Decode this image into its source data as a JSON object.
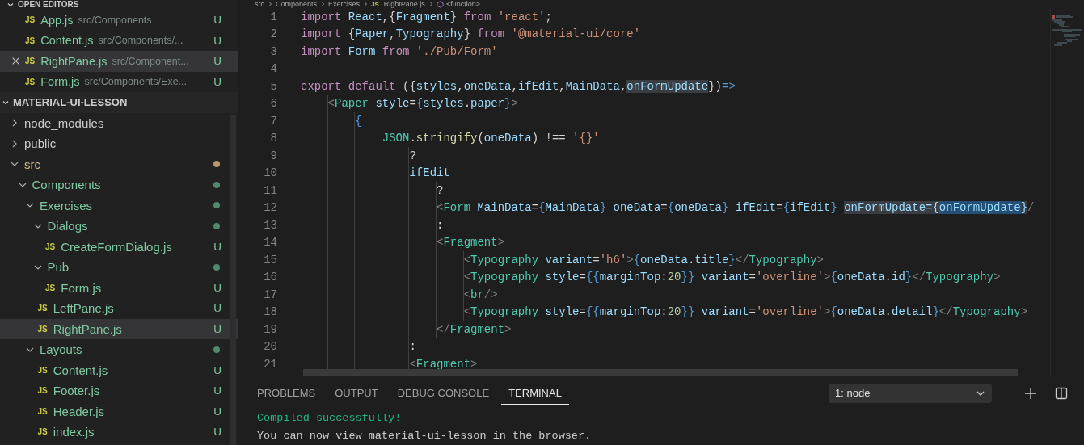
{
  "explorer": {
    "open_editors_title": "OPEN EDITORS",
    "open_editors": [
      {
        "type_icon": "JS",
        "name": "App.js",
        "path": "src/Components",
        "status": "U",
        "selected": false
      },
      {
        "type_icon": "JS",
        "name": "Content.js",
        "path": "src/Components/...",
        "status": "U",
        "selected": false
      },
      {
        "type_icon": "JS",
        "name": "RightPane.js",
        "path": "src/Component...",
        "status": "U",
        "selected": true
      },
      {
        "type_icon": "JS",
        "name": "Form.js",
        "path": "src/Components/Exe...",
        "status": "U",
        "selected": false
      }
    ],
    "project_title": "MATERIAL-UI-LESSON",
    "tree": [
      {
        "kind": "folder",
        "name": "node_modules",
        "expanded": false,
        "selected": false
      },
      {
        "kind": "folder",
        "name": "public",
        "expanded": false,
        "selected": false
      },
      {
        "kind": "folder",
        "name": "src",
        "expanded": true,
        "selected": false,
        "color": "#b89a6a",
        "children": [
          {
            "kind": "folder",
            "name": "Components",
            "expanded": true,
            "selected": false,
            "color": "#4f8a6f",
            "children": [
              {
                "kind": "folder",
                "name": "Exercises",
                "expanded": true,
                "selected": false,
                "color": "#4f8a6f",
                "children": [
                  {
                    "kind": "folder",
                    "name": "Dialogs",
                    "expanded": true,
                    "selected": false,
                    "color": "#4f8a6f",
                    "children": [
                      {
                        "kind": "file",
                        "type_icon": "JS",
                        "name": "CreateFormDialog.js",
                        "status": "U",
                        "selected": false
                      }
                    ]
                  },
                  {
                    "kind": "folder",
                    "name": "Pub",
                    "expanded": true,
                    "selected": false,
                    "color": "#4f8a6f",
                    "children": [
                      {
                        "kind": "file",
                        "type_icon": "JS",
                        "name": "Form.js",
                        "status": "U",
                        "selected": false
                      }
                    ]
                  },
                  {
                    "kind": "file",
                    "type_icon": "JS",
                    "name": "LeftPane.js",
                    "status": "U",
                    "selected": false
                  },
                  {
                    "kind": "file",
                    "type_icon": "JS",
                    "name": "RightPane.js",
                    "status": "U",
                    "selected": true
                  }
                ]
              },
              {
                "kind": "folder",
                "name": "Layouts",
                "expanded": true,
                "selected": false,
                "color": "#4f8a6f",
                "children": [
                  {
                    "kind": "file",
                    "type_icon": "JS",
                    "name": "Content.js",
                    "status": "U",
                    "selected": false
                  },
                  {
                    "kind": "file",
                    "type_icon": "JS",
                    "name": "Footer.js",
                    "status": "U",
                    "selected": false
                  },
                  {
                    "kind": "file",
                    "type_icon": "JS",
                    "name": "Header.js",
                    "status": "U",
                    "selected": false
                  },
                  {
                    "kind": "file",
                    "type_icon": "JS",
                    "name": "index.js",
                    "status": "U",
                    "selected": false
                  }
                ]
              }
            ]
          }
        ]
      }
    ]
  },
  "editor": {
    "breadcrumbs": [
      {
        "kind": "folder",
        "text": "src"
      },
      {
        "kind": "folder",
        "text": "Components"
      },
      {
        "kind": "folder",
        "text": "Exercises"
      },
      {
        "kind": "file",
        "type_icon": "JS",
        "text": "RightPane.js"
      },
      {
        "kind": "symbol",
        "text": "<function>"
      }
    ],
    "lines": [
      {
        "number": "1",
        "tokens": [
          {
            "kind": "kw",
            "text": "import "
          },
          {
            "kind": "var",
            "text": "React"
          },
          {
            "kind": "p",
            "text": ",{"
          },
          {
            "kind": "var",
            "text": "Fragment"
          },
          {
            "kind": "p",
            "text": "} "
          },
          {
            "kind": "kw",
            "text": "from "
          },
          {
            "kind": "str",
            "text": "'react'"
          },
          {
            "kind": "p",
            "text": ";"
          }
        ]
      },
      {
        "number": "2",
        "tokens": [
          {
            "kind": "kw",
            "text": "import "
          },
          {
            "kind": "p",
            "text": "{"
          },
          {
            "kind": "var",
            "text": "Paper"
          },
          {
            "kind": "p",
            "text": ","
          },
          {
            "kind": "var",
            "text": "Typography"
          },
          {
            "kind": "p",
            "text": "} "
          },
          {
            "kind": "kw",
            "text": "from "
          },
          {
            "kind": "str",
            "text": "'@material-ui/core'"
          }
        ]
      },
      {
        "number": "3",
        "tokens": [
          {
            "kind": "kw",
            "text": "import "
          },
          {
            "kind": "var",
            "text": "Form "
          },
          {
            "kind": "kw",
            "text": "from "
          },
          {
            "kind": "str",
            "text": "'./Pub/Form'"
          }
        ]
      },
      {
        "number": "4"
      },
      {
        "number": "5",
        "tokens": [
          {
            "kind": "kw",
            "text": "export default "
          },
          {
            "kind": "p",
            "text": "({"
          },
          {
            "kind": "var",
            "text": "styles"
          },
          {
            "kind": "p",
            "text": ","
          },
          {
            "kind": "var",
            "text": "oneData"
          },
          {
            "kind": "p",
            "text": ","
          },
          {
            "kind": "var",
            "text": "ifEdit"
          },
          {
            "kind": "p",
            "text": ","
          },
          {
            "kind": "var",
            "text": "MainData"
          },
          {
            "kind": "p",
            "text": ","
          },
          {
            "kind": "hl",
            "text": "onFormUpdate"
          },
          {
            "kind": "p",
            "text": "})"
          },
          {
            "kind": "op",
            "text": "=>"
          }
        ],
        "children": [
          {
            "number": "6",
            "tokens": [
              {
                "kind": "angle",
                "text": "<"
              },
              {
                "kind": "tag",
                "text": "Paper "
              },
              {
                "kind": "var",
                "text": "style"
              },
              {
                "kind": "p",
                "text": "="
              },
              {
                "kind": "op",
                "text": "{"
              },
              {
                "kind": "var",
                "text": "styles"
              },
              {
                "kind": "p",
                "text": "."
              },
              {
                "kind": "var",
                "text": "paper"
              },
              {
                "kind": "op",
                "text": "}"
              },
              {
                "kind": "angle",
                "text": ">"
              }
            ],
            "children": [
              {
                "number": "7",
                "tokens": [
                  {
                    "kind": "op",
                    "text": "{"
                  }
                ],
                "children": [
                  {
                    "number": "8",
                    "tokens": [
                      {
                        "kind": "cls",
                        "text": "JSON"
                      },
                      {
                        "kind": "p",
                        "text": "."
                      },
                      {
                        "kind": "fn",
                        "text": "stringify"
                      },
                      {
                        "kind": "p",
                        "text": "("
                      },
                      {
                        "kind": "var",
                        "text": "oneData"
                      },
                      {
                        "kind": "p",
                        "text": ") !== "
                      },
                      {
                        "kind": "str",
                        "text": "'{}'"
                      }
                    ],
                    "children": [
                      {
                        "number": "9",
                        "tokens": [
                          {
                            "kind": "p",
                            "text": "?"
                          }
                        ]
                      },
                      {
                        "number": "10",
                        "tokens": [
                          {
                            "kind": "var",
                            "text": "ifEdit"
                          }
                        ],
                        "children": [
                          {
                            "number": "11",
                            "tokens": [
                              {
                                "kind": "p",
                                "text": "?"
                              }
                            ]
                          },
                          {
                            "number": "12",
                            "tokens": [
                              {
                                "kind": "angle",
                                "text": "<"
                              },
                              {
                                "kind": "tag",
                                "text": "Form "
                              },
                              {
                                "kind": "var",
                                "text": "MainData"
                              },
                              {
                                "kind": "p",
                                "text": "="
                              },
                              {
                                "kind": "op",
                                "text": "{"
                              },
                              {
                                "kind": "var",
                                "text": "MainData"
                              },
                              {
                                "kind": "op",
                                "text": "} "
                              },
                              {
                                "kind": "var",
                                "text": "oneData"
                              },
                              {
                                "kind": "p",
                                "text": "="
                              },
                              {
                                "kind": "op",
                                "text": "{"
                              },
                              {
                                "kind": "var",
                                "text": "oneData"
                              },
                              {
                                "kind": "op",
                                "text": "} "
                              },
                              {
                                "kind": "var",
                                "text": "ifEdit"
                              },
                              {
                                "kind": "p",
                                "text": "="
                              },
                              {
                                "kind": "op",
                                "text": "{"
                              },
                              {
                                "kind": "var",
                                "text": "ifEdit"
                              },
                              {
                                "kind": "op",
                                "text": "} "
                              },
                              {
                                "kind": "hl",
                                "text": "onFormUpdate={"
                              },
                              {
                                "kind": "sel",
                                "text": "onFormUpdate"
                              },
                              {
                                "kind": "hl",
                                "text": "}"
                              },
                              {
                                "kind": "angle",
                                "text": "/"
                              }
                            ]
                          },
                          {
                            "number": "13",
                            "tokens": [
                              {
                                "kind": "p",
                                "text": ":"
                              }
                            ]
                          },
                          {
                            "number": "14",
                            "tokens": [
                              {
                                "kind": "angle",
                                "text": "<"
                              },
                              {
                                "kind": "tag",
                                "text": "Fragment"
                              },
                              {
                                "kind": "angle",
                                "text": ">"
                              }
                            ],
                            "children": [
                              {
                                "number": "15",
                                "tokens": [
                                  {
                                    "kind": "angle",
                                    "text": "<"
                                  },
                                  {
                                    "kind": "tag",
                                    "text": "Typography "
                                  },
                                  {
                                    "kind": "var",
                                    "text": "variant"
                                  },
                                  {
                                    "kind": "p",
                                    "text": "="
                                  },
                                  {
                                    "kind": "str",
                                    "text": "'h6'"
                                  },
                                  {
                                    "kind": "angle",
                                    "text": ">"
                                  },
                                  {
                                    "kind": "op",
                                    "text": "{"
                                  },
                                  {
                                    "kind": "var",
                                    "text": "oneData"
                                  },
                                  {
                                    "kind": "p",
                                    "text": "."
                                  },
                                  {
                                    "kind": "var",
                                    "text": "title"
                                  },
                                  {
                                    "kind": "op",
                                    "text": "}"
                                  },
                                  {
                                    "kind": "angle",
                                    "text": "</"
                                  },
                                  {
                                    "kind": "tag",
                                    "text": "Typography"
                                  },
                                  {
                                    "kind": "angle",
                                    "text": ">"
                                  }
                                ]
                              },
                              {
                                "number": "16",
                                "tokens": [
                                  {
                                    "kind": "angle",
                                    "text": "<"
                                  },
                                  {
                                    "kind": "tag",
                                    "text": "Typography "
                                  },
                                  {
                                    "kind": "var",
                                    "text": "style"
                                  },
                                  {
                                    "kind": "p",
                                    "text": "="
                                  },
                                  {
                                    "kind": "op",
                                    "text": "{{"
                                  },
                                  {
                                    "kind": "var",
                                    "text": "marginTop"
                                  },
                                  {
                                    "kind": "p",
                                    "text": ":"
                                  },
                                  {
                                    "kind": "num",
                                    "text": "20"
                                  },
                                  {
                                    "kind": "op",
                                    "text": "}} "
                                  },
                                  {
                                    "kind": "var",
                                    "text": "variant"
                                  },
                                  {
                                    "kind": "p",
                                    "text": "="
                                  },
                                  {
                                    "kind": "str",
                                    "text": "'overline'"
                                  },
                                  {
                                    "kind": "angle",
                                    "text": ">"
                                  },
                                  {
                                    "kind": "op",
                                    "text": "{"
                                  },
                                  {
                                    "kind": "var",
                                    "text": "oneData"
                                  },
                                  {
                                    "kind": "p",
                                    "text": "."
                                  },
                                  {
                                    "kind": "var",
                                    "text": "id"
                                  },
                                  {
                                    "kind": "op",
                                    "text": "}"
                                  },
                                  {
                                    "kind": "angle",
                                    "text": "</"
                                  },
                                  {
                                    "kind": "tag",
                                    "text": "Typography"
                                  },
                                  {
                                    "kind": "angle",
                                    "text": ">"
                                  }
                                ]
                              },
                              {
                                "number": "17",
                                "tokens": [
                                  {
                                    "kind": "angle",
                                    "text": "<"
                                  },
                                  {
                                    "kind": "tag",
                                    "text": "br"
                                  },
                                  {
                                    "kind": "angle",
                                    "text": "/>"
                                  }
                                ]
                              },
                              {
                                "number": "18",
                                "tokens": [
                                  {
                                    "kind": "angle",
                                    "text": "<"
                                  },
                                  {
                                    "kind": "tag",
                                    "text": "Typography "
                                  },
                                  {
                                    "kind": "var",
                                    "text": "style"
                                  },
                                  {
                                    "kind": "p",
                                    "text": "="
                                  },
                                  {
                                    "kind": "op",
                                    "text": "{{"
                                  },
                                  {
                                    "kind": "var",
                                    "text": "marginTop"
                                  },
                                  {
                                    "kind": "p",
                                    "text": ":"
                                  },
                                  {
                                    "kind": "num",
                                    "text": "20"
                                  },
                                  {
                                    "kind": "op",
                                    "text": "}} "
                                  },
                                  {
                                    "kind": "var",
                                    "text": "variant"
                                  },
                                  {
                                    "kind": "p",
                                    "text": "="
                                  },
                                  {
                                    "kind": "str",
                                    "text": "'overline'"
                                  },
                                  {
                                    "kind": "angle",
                                    "text": ">"
                                  },
                                  {
                                    "kind": "op",
                                    "text": "{"
                                  },
                                  {
                                    "kind": "var",
                                    "text": "oneData"
                                  },
                                  {
                                    "kind": "p",
                                    "text": "."
                                  },
                                  {
                                    "kind": "var",
                                    "text": "detail"
                                  },
                                  {
                                    "kind": "op",
                                    "text": "}"
                                  },
                                  {
                                    "kind": "angle",
                                    "text": "</"
                                  },
                                  {
                                    "kind": "tag",
                                    "text": "Typography"
                                  },
                                  {
                                    "kind": "angle",
                                    "text": ">"
                                  }
                                ]
                              }
                            ]
                          },
                          {
                            "number": "19",
                            "tokens": [
                              {
                                "kind": "angle",
                                "text": "</"
                              },
                              {
                                "kind": "tag",
                                "text": "Fragment"
                              },
                              {
                                "kind": "angle",
                                "text": ">"
                              }
                            ]
                          }
                        ]
                      },
                      {
                        "number": "20",
                        "tokens": [
                          {
                            "kind": "p",
                            "text": ":"
                          }
                        ]
                      },
                      {
                        "number": "21",
                        "tokens": [
                          {
                            "kind": "angle",
                            "text": "<"
                          },
                          {
                            "kind": "tag",
                            "text": "Fragment"
                          },
                          {
                            "kind": "angle",
                            "text": ">"
                          }
                        ]
                      }
                    ]
                  }
                ]
              }
            ]
          }
        ]
      }
    ]
  },
  "panel": {
    "tabs": [
      {
        "label": "PROBLEMS",
        "selected": false
      },
      {
        "label": "OUTPUT",
        "selected": false
      },
      {
        "label": "DEBUG CONSOLE",
        "selected": false
      },
      {
        "label": "TERMINAL",
        "selected": true
      }
    ],
    "terminal_select": {
      "value": "1: node"
    },
    "terminal_lines": [
      {
        "kind": "success",
        "text": "Compiled successfully!"
      },
      {
        "kind": "plain",
        "text": "You can now view material-ui-lesson in the browser."
      }
    ]
  }
}
